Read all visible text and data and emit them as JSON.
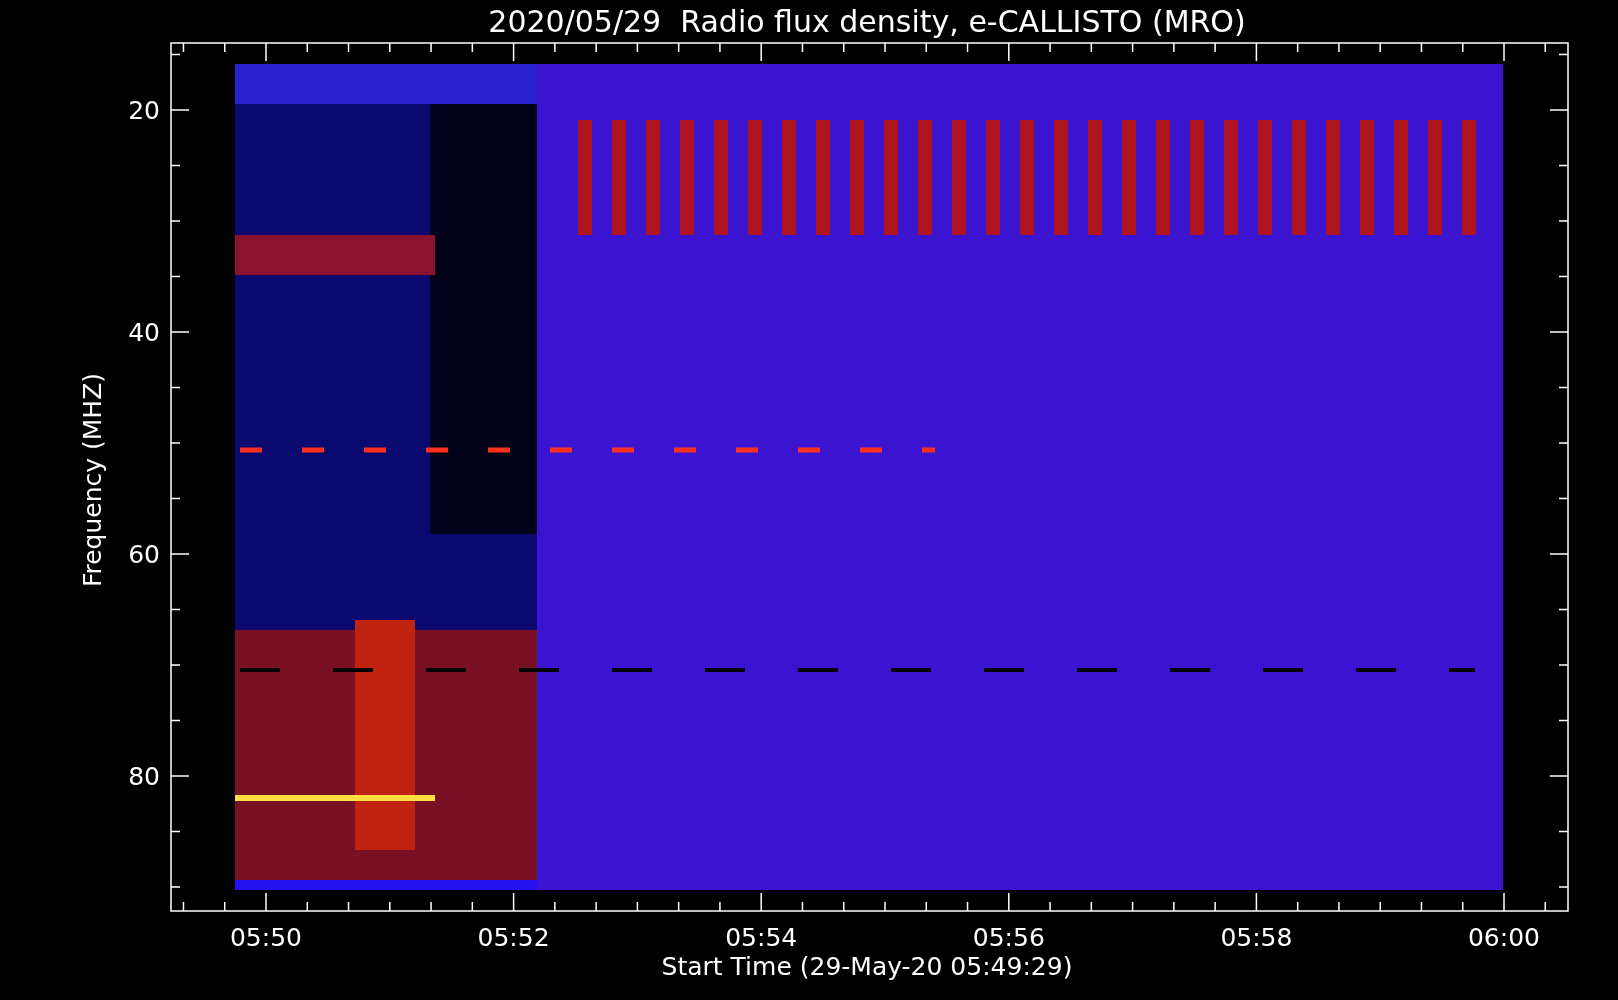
{
  "title": "2020/05/29  Radio flux density, e-CALLISTO (MRO)",
  "y_axis": {
    "label": "Frequency (MHZ)",
    "ticks": [
      "20",
      "40",
      "60",
      "80"
    ]
  },
  "x_axis": {
    "label": "Start Time (29-May-20 05:49:29)",
    "ticks": [
      "05:50",
      "05:52",
      "05:54",
      "05:56",
      "05:58",
      "06:00"
    ]
  }
}
